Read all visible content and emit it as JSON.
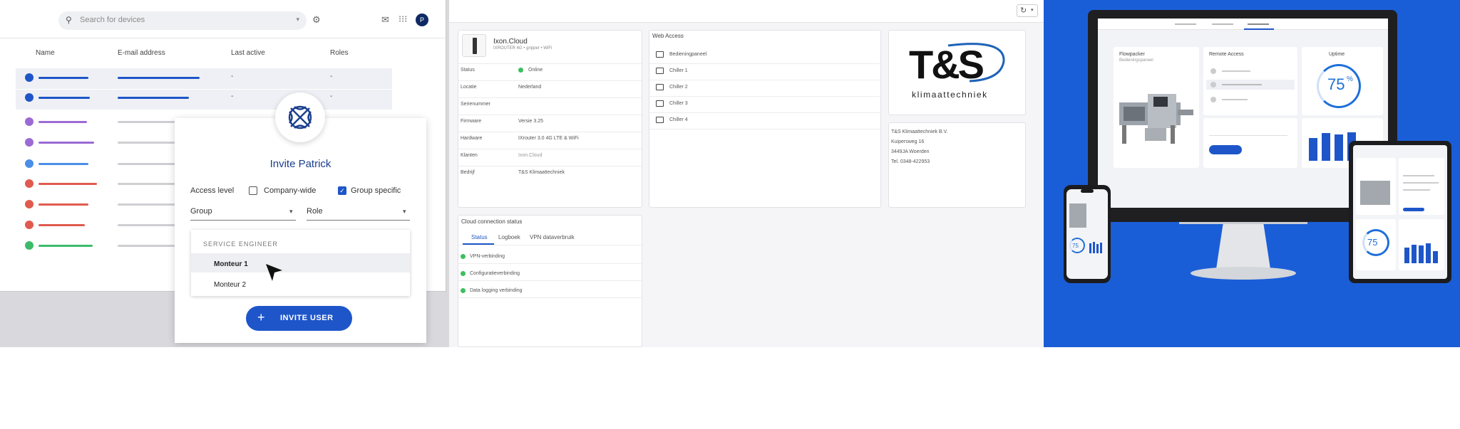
{
  "panel_users": {
    "search_placeholder": "Search for devices",
    "search_icon": "search-icon",
    "settings_icon": "gear-icon",
    "avatar_initial": "P",
    "columns": [
      "Name",
      "E-mail address",
      "Last active",
      "Roles"
    ],
    "row_values": {
      "last_active": "-",
      "roles": "-"
    },
    "row_colors": [
      "#1e56c9",
      "#1e56c9",
      "#9b6ad4",
      "#9b6ad4",
      "#4a8ee8",
      "#e05a4f",
      "#e05a4f",
      "#e05a4f",
      "#3dbb6b"
    ],
    "invite": {
      "title": "Invite Patrick",
      "access_label": "Access level",
      "option_company": "Company-wide",
      "option_group": "Group specific",
      "company_checked": false,
      "group_checked": true,
      "group_label": "Group",
      "role_label": "Role",
      "dropdown_header": "SERVICE ENGINEER",
      "dropdown_items": [
        "Monteur 1",
        "Monteur 2"
      ],
      "button_label": "INVITE USER"
    }
  },
  "panel_ixon": {
    "device_name": "Ixon.Cloud",
    "device_sub": "IXROUTER 4G • gripper • WiFi",
    "info": [
      {
        "label": "Status",
        "value": "Online"
      },
      {
        "label": "Locatie",
        "value": "Nederland"
      },
      {
        "label": "Serienummer",
        "value": ""
      },
      {
        "label": "Firmware",
        "value": "Versie 3.25"
      },
      {
        "label": "Hardware",
        "value": "IXrouter 3.0 4G LTE & WiFi"
      },
      {
        "label": "Klanten",
        "value": "Ixon.Cloud"
      },
      {
        "label": "Bedrijf",
        "value": "T&S Klimaattechniek"
      }
    ],
    "web_access_title": "Web Access",
    "web_access": [
      "Bedieningpaneel",
      "Chiller 1",
      "Chiller 2",
      "Chiller 3",
      "Chiller 4"
    ],
    "logo_main": "T&S",
    "logo_sub": "klimaattechniek",
    "company_address": [
      "T&S Klimaattechniek B.V.",
      "Kuipersweg 16",
      "3449JA Woerden",
      "Tel. 0348-422953"
    ],
    "cloud_title": "Cloud connection status",
    "cloud_tabs": [
      "Status",
      "Logboek",
      "VPN dataverbruik"
    ],
    "cloud_items": [
      "VPN-verbinding",
      "Configuratieverbinding",
      "Data logging verbinding"
    ],
    "status_color": "#3cbf5c"
  },
  "panel_devices": {
    "background": "#1a5ed7",
    "monitor": {
      "tabs": [
        "",
        "",
        ""
      ],
      "machine_title": "Flowpacker",
      "machine_sub": "Bedieningspaneel",
      "remote_title": "Remote Access",
      "uptime_title": "Uptime",
      "uptime_percent": "75",
      "bar_values": [
        0.72,
        0.88,
        0.84,
        0.92,
        0.55
      ]
    },
    "tablet": {
      "uptime_percent": "75"
    },
    "phone": {
      "uptime_percent": "75"
    }
  }
}
